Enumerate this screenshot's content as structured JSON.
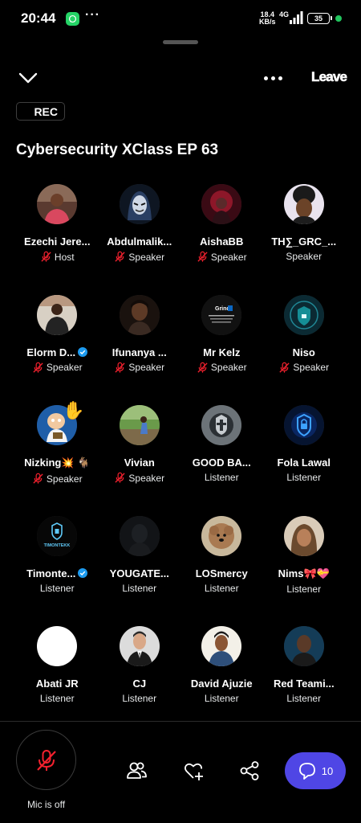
{
  "status_bar": {
    "time": "20:44",
    "net_speed_value": "18.4",
    "net_speed_unit": "KB/s",
    "network": "4G",
    "battery": "35",
    "dots": "···"
  },
  "header": {
    "leave_label": "Leave",
    "rec_label": "REC",
    "title": "Cybersecurity XClass EP 63"
  },
  "participants": [
    {
      "name": "Ezechi Jere...",
      "role": "Host",
      "mic_muted": true
    },
    {
      "name": "Abdulmalik...",
      "role": "Speaker",
      "mic_muted": true
    },
    {
      "name": "AishaBB",
      "role": "Speaker",
      "mic_muted": true
    },
    {
      "name": "TH∑_GRC_...",
      "role": "Speaker",
      "mic_muted": false
    },
    {
      "name": "Elorm D...",
      "role": "Speaker",
      "mic_muted": true,
      "verified": true
    },
    {
      "name": "Ifunanya ...",
      "role": "Speaker",
      "mic_muted": true
    },
    {
      "name": "Mr Kelz",
      "role": "Speaker",
      "mic_muted": true
    },
    {
      "name": "Niso",
      "role": "Speaker",
      "mic_muted": true
    },
    {
      "name": "Nizking💥 🐐",
      "role": "Speaker",
      "mic_muted": true,
      "hand": "✋"
    },
    {
      "name": "Vivian",
      "role": "Speaker",
      "mic_muted": true
    },
    {
      "name": "GOOD BA...",
      "role": "Listener"
    },
    {
      "name": "Fola Lawal",
      "role": "Listener"
    },
    {
      "name": "Timonte...",
      "role": "Listener",
      "verified": true
    },
    {
      "name": "YOUGATE...",
      "role": "Listener"
    },
    {
      "name": "LOSmercy",
      "role": "Listener"
    },
    {
      "name": "Nims🎀💝",
      "role": "Listener"
    },
    {
      "name": "Abati JR",
      "role": "Listener"
    },
    {
      "name": "CJ",
      "role": "Listener"
    },
    {
      "name": "David Ajuzie",
      "role": "Listener"
    },
    {
      "name": "Red Teami...",
      "role": "Listener"
    }
  ],
  "avatar_images": {
    "mr_kelz_text": "Grind",
    "timontekk_text": "TIMONTEKK"
  },
  "bottom_bar": {
    "mic_label": "Mic is off",
    "chat_count": "10"
  },
  "colors": {
    "accent": "#4f46e5",
    "mic_off": "#f4212e",
    "verified": "#1d9bf0",
    "background": "#000000"
  },
  "icons": {
    "collapse": "chevron-down-icon",
    "more": "more-dots-icon",
    "mic_off": "mic-off-icon",
    "people": "people-icon",
    "reaction": "heart-plus-icon",
    "share": "share-icon",
    "chat": "chat-bubble-icon"
  }
}
